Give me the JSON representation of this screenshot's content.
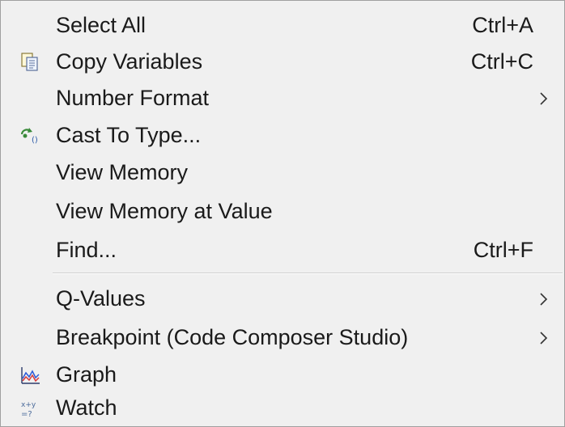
{
  "menu": {
    "items": [
      {
        "label": "Select All",
        "shortcut": "Ctrl+A"
      },
      {
        "label": "Copy Variables",
        "shortcut": "Ctrl+C",
        "icon": "copy-icon"
      },
      {
        "label": "Number Format",
        "submenu": true
      },
      {
        "label": "Cast To Type...",
        "icon": "cast-icon"
      },
      {
        "label": "View Memory"
      },
      {
        "label": "View Memory at Value"
      },
      {
        "label": "Find...",
        "shortcut": "Ctrl+F"
      },
      {
        "label": "Q-Values",
        "submenu": true
      },
      {
        "label": "Breakpoint (Code Composer Studio)",
        "submenu": true
      },
      {
        "label": "Graph",
        "icon": "graph-icon"
      },
      {
        "label": "Watch",
        "icon": "watch-icon"
      }
    ]
  },
  "colors": {
    "menu_background": "#f0f0f0",
    "text": "#1a1a1a",
    "separator": "#cfcfcf"
  }
}
